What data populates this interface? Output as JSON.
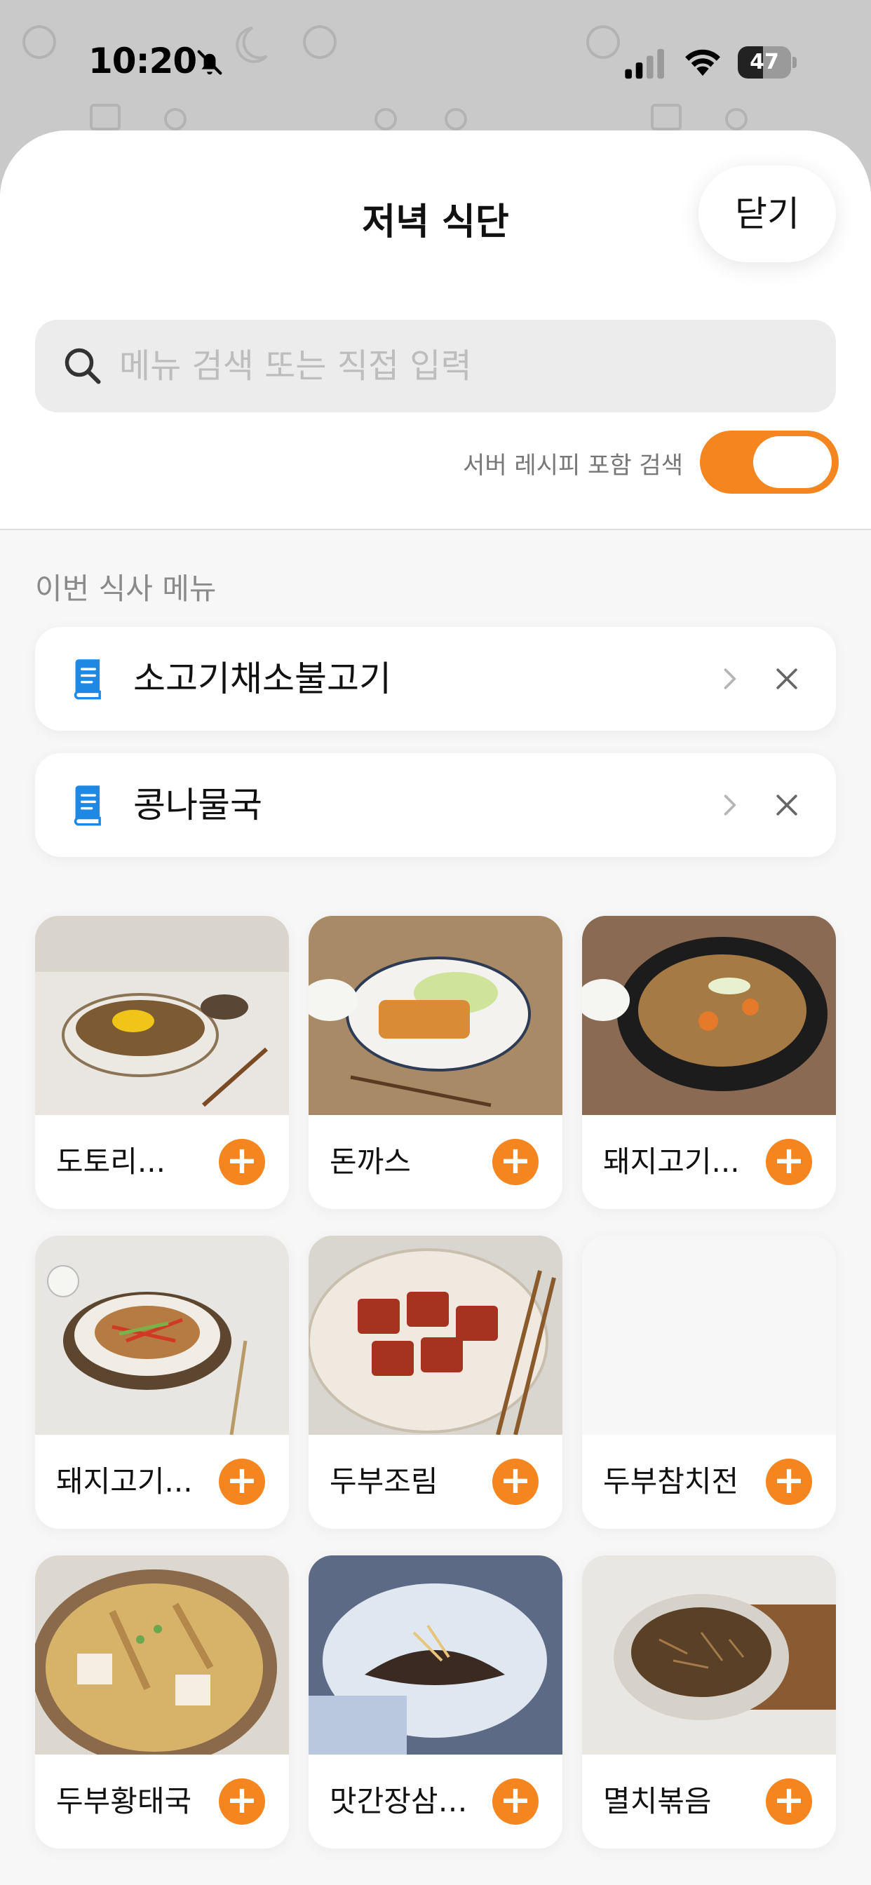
{
  "status_bar": {
    "time": "10:20",
    "battery_level": "47",
    "battery_fraction": 0.47
  },
  "sheet": {
    "title": "저녁 식단",
    "close_label": "닫기"
  },
  "search": {
    "placeholder": "메뉴 검색 또는 직접 입력",
    "value": ""
  },
  "server_toggle": {
    "label": "서버 레시피 포함 검색",
    "on": true
  },
  "colors": {
    "accent": "#f5861f",
    "doc_icon": "#1e88e5",
    "sheet_bg": "#f7f7f7"
  },
  "current_meal": {
    "label": "이번 식사 메뉴",
    "items": [
      {
        "name": "소고기채소불고기",
        "icon": "document-icon"
      },
      {
        "name": "콩나물국",
        "icon": "document-icon"
      }
    ]
  },
  "recipes": [
    {
      "name": "도토리...",
      "has_image": true
    },
    {
      "name": "돈까스",
      "has_image": true
    },
    {
      "name": "돼지고기...",
      "has_image": true
    },
    {
      "name": "돼지고기...",
      "has_image": true
    },
    {
      "name": "두부조림",
      "has_image": true
    },
    {
      "name": "두부참치전",
      "has_image": false
    },
    {
      "name": "두부황태국",
      "has_image": true
    },
    {
      "name": "맛간장삼…",
      "has_image": true
    },
    {
      "name": "멸치볶음",
      "has_image": true
    }
  ]
}
